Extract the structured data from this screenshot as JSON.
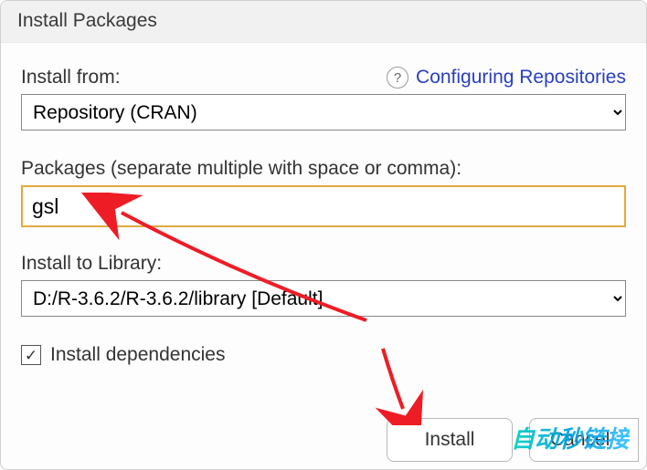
{
  "title": "Install Packages",
  "install_from_label": "Install from:",
  "configuring_link": "Configuring Repositories",
  "install_from_value": "Repository (CRAN)",
  "packages_label": "Packages (separate multiple with space or comma):",
  "packages_value": "gsl",
  "library_label": "Install to Library:",
  "library_value": "D:/R-3.6.2/R-3.6.2/library [Default]",
  "dependencies_label": "Install dependencies",
  "dependencies_checked": true,
  "buttons": {
    "install": "Install",
    "cancel": "Cancel"
  },
  "watermark": "自动秒链接"
}
